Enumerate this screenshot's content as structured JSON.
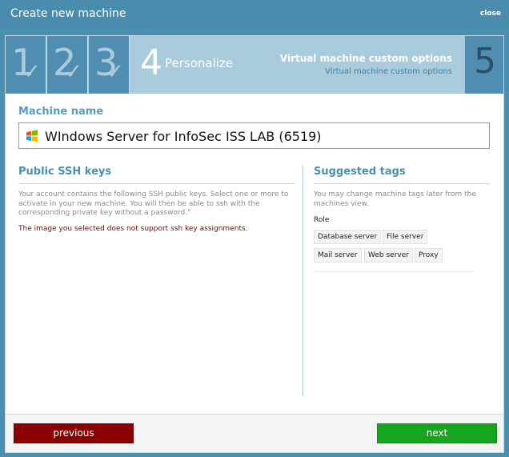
{
  "window": {
    "title": "Create new machine",
    "close_label": "close"
  },
  "wizard": {
    "completed_steps": [
      "1",
      "2",
      "3"
    ],
    "current_step": {
      "number": "4",
      "label": "Personalize",
      "desc_title": "Virtual machine custom options",
      "desc_sub": "Virtual machine custom options"
    },
    "next_step": "5"
  },
  "machine": {
    "label": "Machine name",
    "value": "WIndows Server for InfoSec ISS LAB (6519)",
    "icon": "windows-logo-icon"
  },
  "ssh": {
    "title": "Public SSH keys",
    "description": "Your account contains the following SSH public keys. Select one or more to activate in your new machine. You will then be able to ssh with the corresponding private key without a password.\"",
    "warning": "The image you selected does not support ssh key assignments."
  },
  "tags": {
    "title": "Suggested tags",
    "description": "You may change machine tags later from the machines view.",
    "group_label": "Role",
    "items": [
      "Database server",
      "File server",
      "Mail server",
      "Web server",
      "Proxy"
    ]
  },
  "footer": {
    "previous_label": "previous",
    "next_label": "next"
  },
  "colors": {
    "accent": "#4b8fb0",
    "previous_button": "#8b0000",
    "next_button": "#16a51e",
    "warning_text": "#8b0000"
  }
}
